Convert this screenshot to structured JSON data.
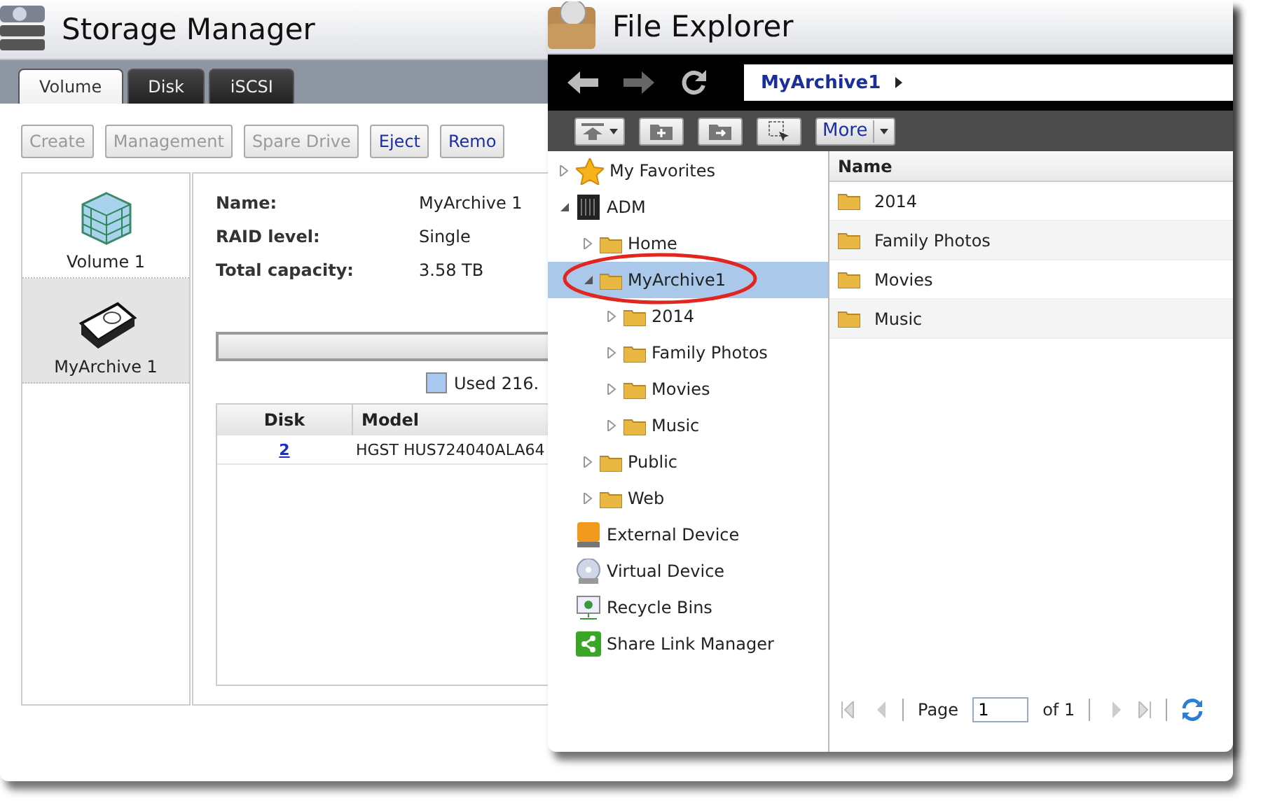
{
  "storage_manager": {
    "title": "Storage Manager",
    "tabs": [
      {
        "label": "Volume",
        "selected": true
      },
      {
        "label": "Disk",
        "selected": false
      },
      {
        "label": "iSCSI",
        "selected": false
      }
    ],
    "buttons": [
      {
        "label": "Create",
        "disabled": true
      },
      {
        "label": "Management",
        "disabled": true
      },
      {
        "label": "Spare Drive",
        "disabled": true
      },
      {
        "label": "Eject",
        "disabled": false
      },
      {
        "label": "Remo",
        "disabled": false
      }
    ],
    "volumes": [
      {
        "kind": "volume",
        "label": "Volume 1",
        "selected": false
      },
      {
        "kind": "disk",
        "label": "MyArchive 1",
        "selected": true
      }
    ],
    "details": [
      {
        "label": "Name:",
        "value": "MyArchive 1"
      },
      {
        "label": "RAID level:",
        "value": "Single"
      },
      {
        "label": "Total capacity:",
        "value": "3.58 TB"
      }
    ],
    "usage_legend": "Used 216.",
    "disk_table": {
      "columns": [
        "Disk",
        "Model"
      ],
      "rows": [
        [
          "2",
          "HGST HUS724040ALA64"
        ]
      ]
    }
  },
  "file_explorer": {
    "title": "File Explorer",
    "path": "MyArchive1",
    "more_button": "More",
    "tree": [
      {
        "kind": "favorites",
        "label": "My Favorites",
        "expanded": false,
        "selected": false
      },
      {
        "kind": "server",
        "label": "ADM",
        "expanded": true,
        "selected": false,
        "children": [
          {
            "kind": "folder",
            "label": "Home",
            "expanded": false,
            "selected": false
          },
          {
            "kind": "folder",
            "label": "MyArchive1",
            "expanded": true,
            "selected": true,
            "children": [
              {
                "kind": "folder",
                "label": "2014",
                "expanded": false,
                "selected": false
              },
              {
                "kind": "folder",
                "label": "Family Photos",
                "expanded": false,
                "selected": false
              },
              {
                "kind": "folder",
                "label": "Movies",
                "expanded": false,
                "selected": false
              },
              {
                "kind": "folder",
                "label": "Music",
                "expanded": false,
                "selected": false
              }
            ]
          },
          {
            "kind": "folder",
            "label": "Public",
            "expanded": false,
            "selected": false
          },
          {
            "kind": "folder",
            "label": "Web",
            "expanded": false,
            "selected": false
          }
        ]
      },
      {
        "kind": "external",
        "label": "External Device"
      },
      {
        "kind": "virtual",
        "label": "Virtual Device"
      },
      {
        "kind": "recycle",
        "label": "Recycle Bins"
      },
      {
        "kind": "share",
        "label": "Share Link Manager"
      }
    ],
    "list_header": "Name",
    "files": [
      "2014",
      "Family Photos",
      "Movies",
      "Music"
    ],
    "pager": {
      "page_label": "Page",
      "page": "1",
      "of": "of 1"
    }
  }
}
